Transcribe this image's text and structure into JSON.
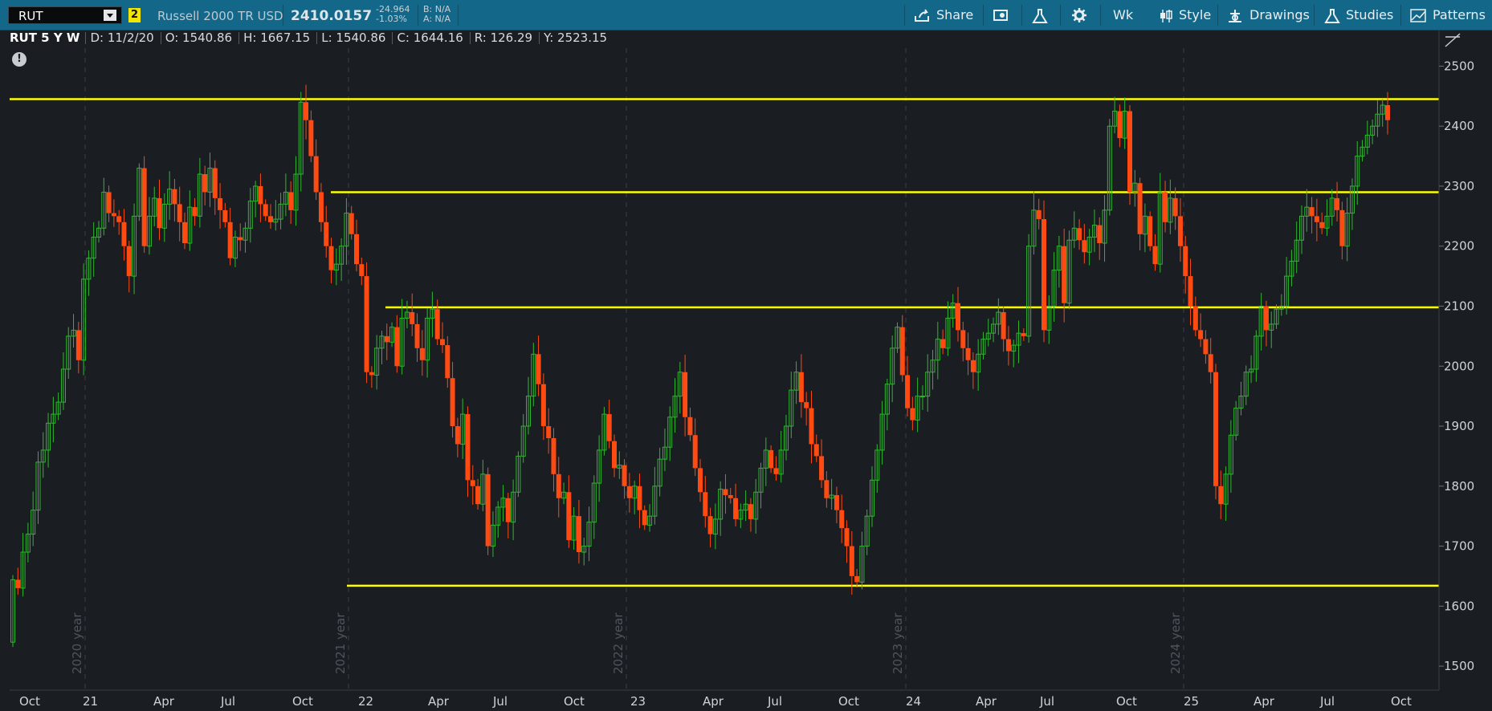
{
  "toolbar": {
    "symbol": "RUT",
    "link_badge": "2",
    "description": "Russell 2000 TR USD",
    "last_price": "2410.0157",
    "net_change": "-24.964",
    "pct_change": "-1.03%",
    "bid": "B: N/A",
    "ask": "A: N/A",
    "share_label": "Share",
    "aggregation_label": "Wk",
    "style_label": "Style",
    "drawings_label": "Drawings",
    "studies_label": "Studies",
    "patterns_label": "Patterns"
  },
  "info_bar": {
    "symbol_label": "RUT 5 Y W",
    "date": "D: 11/2/20",
    "open": "O: 1540.86",
    "high": "H: 1667.15",
    "low": "L: 1540.86",
    "close": "C: 1644.16",
    "range": "R: 126.29",
    "y_value": "Y: 2523.15"
  },
  "alert_icon_glyph": "!",
  "colors": {
    "toolbar_bg": "#136789",
    "chart_bg": "#1a1d22",
    "up_candle": "#2fb82f",
    "down_candle": "#ff4a12",
    "horizontal_line": "#ffff00",
    "year_separator": "#3a3f45"
  },
  "chart_data": {
    "type": "candlestick",
    "title": "RUT 5 Y W",
    "ylim": [
      1460,
      2530
    ],
    "y_ticks": [
      1500,
      1600,
      1700,
      1800,
      1900,
      2000,
      2100,
      2200,
      2300,
      2400,
      2500
    ],
    "x_tick_labels": [
      "Oct",
      "21",
      "Apr",
      "Jul",
      "Oct",
      "22",
      "Apr",
      "Jul",
      "Oct",
      "23",
      "Apr",
      "Jul",
      "Oct",
      "24",
      "Apr",
      "Jul",
      "Oct",
      "25",
      "Apr",
      "Jul",
      "Oct"
    ],
    "year_separators": [
      "2020 year",
      "2021 year",
      "2022 year",
      "2023 year",
      "2024 year"
    ],
    "horizontal_lines": [
      {
        "level": 2445
      },
      {
        "level": 2290
      },
      {
        "level": 2098
      },
      {
        "level": 1634
      }
    ],
    "closes": [
      1644,
      1630,
      1690,
      1720,
      1760,
      1840,
      1860,
      1905,
      1920,
      1940,
      1995,
      2050,
      2060,
      2010,
      2145,
      2180,
      2215,
      2230,
      2290,
      2255,
      2250,
      2240,
      2200,
      2150,
      2250,
      2330,
      2200,
      2250,
      2280,
      2230,
      2270,
      2295,
      2270,
      2240,
      2205,
      2265,
      2250,
      2320,
      2290,
      2330,
      2280,
      2260,
      2240,
      2180,
      2215,
      2210,
      2230,
      2275,
      2300,
      2270,
      2250,
      2240,
      2245,
      2270,
      2290,
      2260,
      2320,
      2440,
      2410,
      2350,
      2290,
      2240,
      2200,
      2160,
      2170,
      2200,
      2255,
      2220,
      2170,
      2150,
      1990,
      1985,
      2030,
      2050,
      2040,
      2065,
      2000,
      2080,
      2090,
      2070,
      2030,
      2010,
      2080,
      2095,
      2045,
      2035,
      1980,
      1900,
      1870,
      1920,
      1810,
      1800,
      1770,
      1820,
      1700,
      1735,
      1765,
      1780,
      1740,
      1790,
      1850,
      1900,
      1950,
      2020,
      1970,
      1900,
      1880,
      1820,
      1780,
      1790,
      1710,
      1750,
      1690,
      1700,
      1740,
      1805,
      1860,
      1920,
      1875,
      1830,
      1835,
      1800,
      1780,
      1800,
      1760,
      1735,
      1750,
      1800,
      1845,
      1865,
      1915,
      1950,
      1990,
      1915,
      1885,
      1830,
      1790,
      1750,
      1720,
      1745,
      1795,
      1785,
      1780,
      1745,
      1760,
      1770,
      1745,
      1790,
      1830,
      1860,
      1830,
      1820,
      1860,
      1900,
      1960,
      1990,
      1940,
      1930,
      1870,
      1850,
      1810,
      1780,
      1785,
      1760,
      1730,
      1700,
      1650,
      1640,
      1700,
      1750,
      1810,
      1860,
      1920,
      1970,
      2030,
      2065,
      1985,
      1930,
      1910,
      1950,
      1950,
      1990,
      2010,
      2045,
      2030,
      2080,
      2105,
      2060,
      2030,
      2010,
      1990,
      2020,
      2045,
      2055,
      2070,
      2090,
      2045,
      2025,
      2035,
      2055,
      2050,
      2200,
      2260,
      2245,
      2060,
      2100,
      2160,
      2200,
      2105,
      2210,
      2230,
      2210,
      2190,
      2215,
      2235,
      2205,
      2260,
      2400,
      2425,
      2380,
      2425,
      2290,
      2305,
      2220,
      2250,
      2200,
      2170,
      2290,
      2240,
      2280,
      2250,
      2200,
      2150,
      2100,
      2060,
      2045,
      2020,
      1990,
      1800,
      1770,
      1820,
      1885,
      1930,
      1950,
      1990,
      1995,
      2050,
      2100,
      2060,
      2070,
      2095,
      2100,
      2150,
      2175,
      2210,
      2250,
      2265,
      2250,
      2240,
      2230,
      2250,
      2280,
      2260,
      2200,
      2255,
      2300,
      2350,
      2365,
      2385,
      2400,
      2420,
      2435,
      2410
    ]
  }
}
